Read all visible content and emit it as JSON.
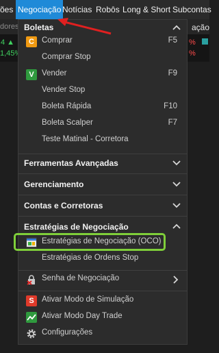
{
  "menubar": {
    "items": [
      "ões",
      "Negociação",
      "Notícias",
      "Robôs",
      "Long & Short",
      "Subcontas"
    ]
  },
  "background": {
    "row1_left": "dores",
    "row1_right": "ação",
    "row2_left_top": "4 ▲",
    "row2_left_bottom": "1,45%",
    "row2_right_top": "%",
    "row2_right_bottom": "%"
  },
  "menu": {
    "sections": {
      "boletas": "Boletas",
      "ferramentas": "Ferramentas Avançadas",
      "gerenciamento": "Gerenciamento",
      "contas": "Contas e Corretoras",
      "estrategias": "Estratégias de Negociação"
    },
    "items": {
      "comprar": {
        "icon": "C",
        "label": "Comprar",
        "shortcut": "F5"
      },
      "comprar_stop": {
        "label": "Comprar Stop"
      },
      "vender": {
        "icon": "V",
        "label": "Vender",
        "shortcut": "F9"
      },
      "vender_stop": {
        "label": "Vender Stop"
      },
      "boleta_rapida": {
        "label": "Boleta Rápida",
        "shortcut": "F10"
      },
      "boleta_scalper": {
        "label": "Boleta Scalper",
        "shortcut": "F7"
      },
      "teste_matinal": {
        "label": "Teste Matinal - Corretora"
      },
      "estrategias_oco": {
        "label": "Estratégias de Negociação (OCO)"
      },
      "estrategias_stop": {
        "label": "Estratégias de Ordens Stop"
      },
      "senha": {
        "label": "Senha de Negociação"
      },
      "simulacao": {
        "icon": "S",
        "label": "Ativar Modo de Simulação"
      },
      "day_trade": {
        "label": "Ativar Modo Day Trade"
      },
      "configuracoes": {
        "label": "Configurações"
      }
    }
  },
  "colors": {
    "accent": "#1f8ad8",
    "highlight": "#7fcf3a",
    "arrow": "#e02020",
    "comprar_icon": "#f09a12",
    "vender_icon": "#2f9a3e",
    "simulacao_icon": "#e03a2a"
  }
}
